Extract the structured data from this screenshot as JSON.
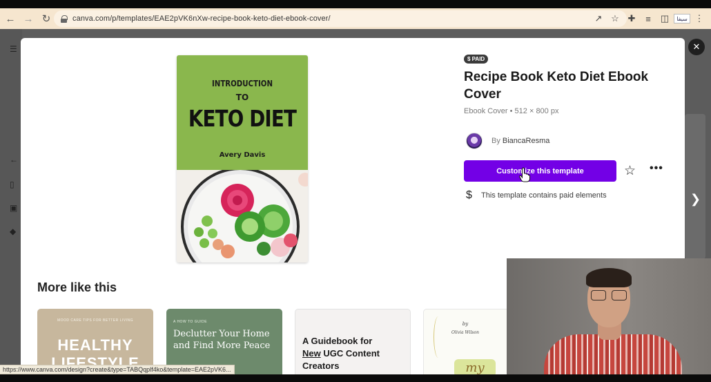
{
  "browser": {
    "url": "canva.com/p/templates/EAE2pVK6nXw-recipe-book-keto-diet-ebook-cover/",
    "profile_label": "سيفا",
    "status_url": "https://www.canva.com/design?create&type=TABQqplf4ko&template=EAE2pVK6..."
  },
  "template": {
    "badge": "$ PAID",
    "title": "Recipe Book Keto Diet Ebook Cover",
    "subtitle": "Ebook Cover • 512 × 800 px",
    "by_prefix": "By",
    "author": "BiancaResma",
    "cta_label": "Customize this template",
    "paid_note": "This template contains paid elements",
    "dollar_icon_char": "$"
  },
  "cover": {
    "intro": "INTRODUCTION",
    "to": "TO",
    "title": "KETO DIET",
    "author": "Avery Davis",
    "accent": "#8ab74d"
  },
  "section": {
    "more_like_this": "More like this"
  },
  "cards": [
    {
      "small": "MOOD CARE TIPS FOR BETTER LIVING",
      "line1": "HEALTHY",
      "line2": "LIFESTYLE"
    },
    {
      "small": "A HOW TO GUIDE",
      "text": "Declutter Your Home and Find More Peace"
    },
    {
      "pre": "A Guidebook for",
      "underlined": "New",
      "post": "UGC Content Creators"
    },
    {
      "by": "by",
      "name": "Olivia Wilson",
      "word": "my"
    }
  ],
  "colors": {
    "brand_purple": "#7300e6",
    "chrome_bg": "#f6e6cf"
  }
}
